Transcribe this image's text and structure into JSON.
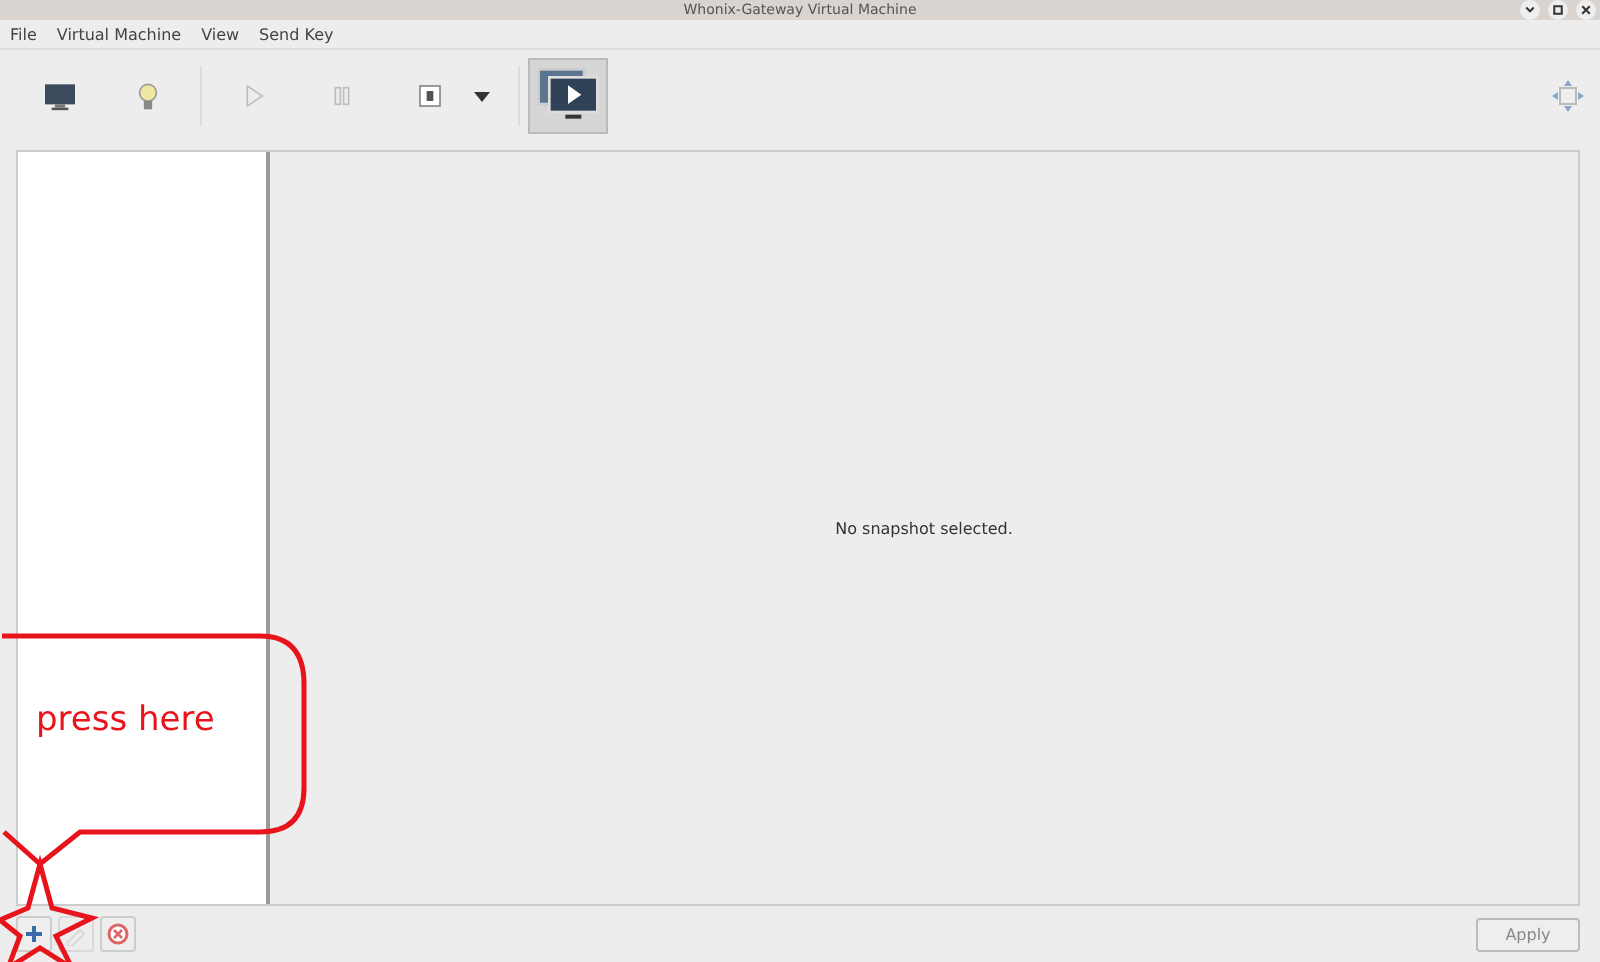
{
  "window": {
    "title": "Whonix-Gateway Virtual Machine"
  },
  "menu": [
    "File",
    "Virtual Machine",
    "View",
    "Send Key"
  ],
  "toolbar": [
    {
      "kind": "console",
      "disabled": false,
      "selected": false
    },
    {
      "kind": "details",
      "disabled": false,
      "selected": false
    },
    {
      "kind": "run",
      "disabled": true,
      "selected": false
    },
    {
      "kind": "pause",
      "disabled": true,
      "selected": false
    },
    {
      "kind": "shutdown",
      "disabled": false,
      "selected": false
    },
    {
      "kind": "snapshots",
      "disabled": false,
      "selected": true
    }
  ],
  "details": {
    "message": "No snapshot selected."
  },
  "annotation": {
    "text": "press here"
  },
  "bottom": {
    "buttons": [
      {
        "kind": "add",
        "disabled": false
      },
      {
        "kind": "edit",
        "disabled": true
      },
      {
        "kind": "delete",
        "disabled": false
      }
    ],
    "apply": {
      "label": "Apply",
      "disabled": true
    }
  }
}
